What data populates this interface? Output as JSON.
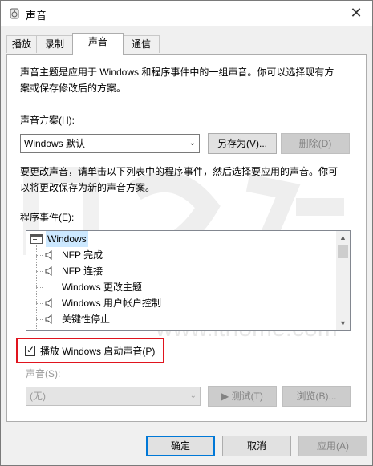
{
  "window": {
    "title": "声音",
    "close_glyph": "✕"
  },
  "tabs": [
    {
      "label": "播放"
    },
    {
      "label": "录制"
    },
    {
      "label": "声音",
      "active": true
    },
    {
      "label": "通信"
    }
  ],
  "intro_line1": "声音主题是应用于 Windows 和程序事件中的一组声音。你可以选择现有方",
  "intro_line2": "案或保存修改后的方案。",
  "scheme": {
    "label": "声音方案(H):",
    "value": "Windows 默认",
    "save_as_label": "另存为(V)...",
    "delete_label": "删除(D)"
  },
  "instructions_line1": "要更改声音，请单击以下列表中的程序事件，然后选择要应用的声音。你可",
  "instructions_line2": "以将更改保存为新的声音方案。",
  "events": {
    "label": "程序事件(E):",
    "items": [
      {
        "label": "Windows",
        "level": 0,
        "icon": "window-icon",
        "selected": true
      },
      {
        "label": "NFP 完成",
        "level": 1,
        "icon": "speaker-icon"
      },
      {
        "label": "NFP 连接",
        "level": 1,
        "icon": "speaker-icon"
      },
      {
        "label": "Windows 更改主题",
        "level": 1,
        "icon": ""
      },
      {
        "label": "Windows 用户帐户控制",
        "level": 1,
        "icon": "speaker-icon"
      },
      {
        "label": "关键性停止",
        "level": 1,
        "icon": "speaker-icon"
      }
    ]
  },
  "startup_checkbox": {
    "label": "播放 Windows 启动声音(P)",
    "checked": true
  },
  "sound": {
    "label": "声音(S):",
    "value": "(无)",
    "test_label": "▶ 测试(T)",
    "browse_label": "浏览(B)..."
  },
  "footer": {
    "ok_label": "确定",
    "cancel_label": "取消",
    "apply_label": "应用(A)"
  },
  "watermark": {
    "url_text": "www.ithome.com"
  },
  "colors": {
    "highlight": "#e0141e",
    "focus": "#0078d7",
    "selection": "#cce8ff"
  }
}
